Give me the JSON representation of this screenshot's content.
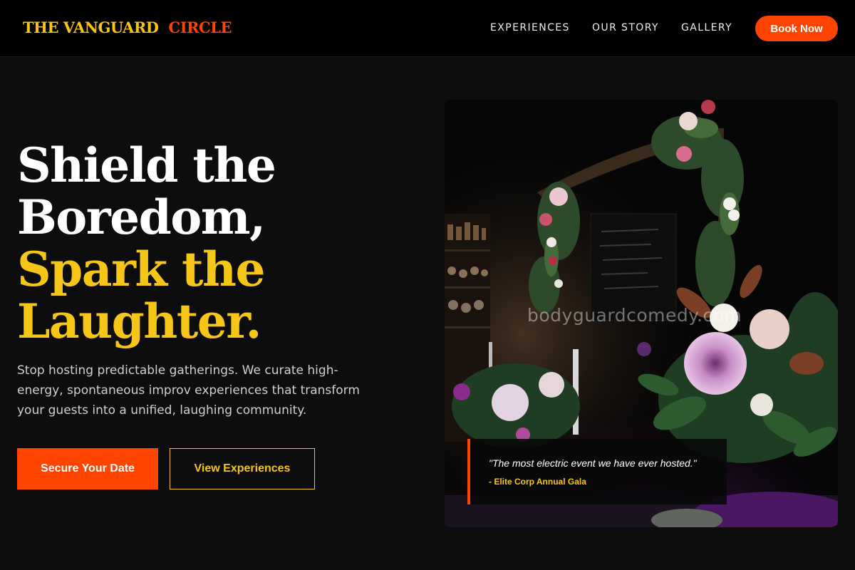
{
  "brand": {
    "name_part1": "THE VANGUARD",
    "name_part2": "CIRCLE",
    "primary_color": "#f5c518",
    "accent_color": "#ff4500"
  },
  "nav": {
    "links": [
      "EXPERIENCES",
      "OUR STORY",
      "GALLERY"
    ],
    "cta_label": "Book Now"
  },
  "hero": {
    "headline_line1": "Shield the",
    "headline_line2": "Boredom,",
    "headline_line3": "Spark the",
    "headline_line4": "Laughter.",
    "subtext": "Stop hosting predictable gatherings. We curate high-energy, spontaneous improv experiences that transform your guests into a unified, laughing community.",
    "primary_cta": "Secure Your Date",
    "secondary_cta": "View Experiences"
  },
  "image": {
    "watermark": "bodyguardcomedy.com",
    "quote": "\"The most electric event we have ever hosted.\"",
    "quote_source": "- Elite Corp Annual Gala"
  }
}
